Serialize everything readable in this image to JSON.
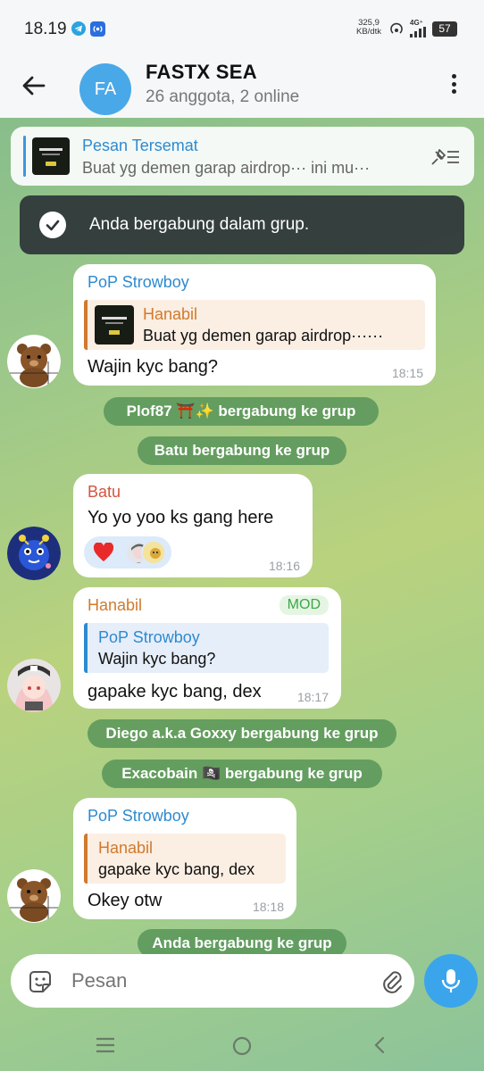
{
  "status_bar": {
    "time": "18.19",
    "net_speed_value": "325,9",
    "net_speed_unit": "KB/dtk",
    "network": "4G⁺",
    "battery": "57"
  },
  "header": {
    "avatar_initials": "FA",
    "title": "FASTX SEA",
    "subtitle": "26 anggota, 2 online"
  },
  "pinned": {
    "title": "Pesan Tersemat",
    "text": "Buat yg demen garap airdrop··· ini mu···"
  },
  "toast": {
    "text": "Anda bergabung dalam grup."
  },
  "messages": [
    {
      "sender": "PoP Strowboy",
      "sender_color": "#2e8ad0",
      "quote_name": "Hanabil",
      "quote_text": "Buat yg demen garap airdrop······",
      "text": "Wajin kyc bang?",
      "time": "18:15"
    },
    {
      "sender": "Batu",
      "sender_color": "#d2553f",
      "text": "Yo yo yoo ks gang here",
      "time": "18:16"
    },
    {
      "sender": "Hanabil",
      "sender_color": "#d07a2e",
      "badge": "MOD",
      "quote_name": "PoP Strowboy",
      "quote_text": "Wajin kyc bang?",
      "text": "gapake kyc bang, dex",
      "time": "18:17"
    },
    {
      "sender": "PoP Strowboy",
      "sender_color": "#2e8ad0",
      "quote_name": "Hanabil",
      "quote_text": "gapake kyc bang, dex",
      "text": "Okey otw",
      "time": "18:18"
    }
  ],
  "system_messages": {
    "plof": "Plof87 ⛩️✨ bergabung ke grup",
    "batu": "Batu bergabung ke grup",
    "diego": "Diego a.k.a Goxxy bergabung ke grup",
    "exacobain": "Exacobain 🏴‍☠️ bergabung ke grup",
    "anda": "Anda bergabung ke grup"
  },
  "reactions": [
    "heart"
  ],
  "input": {
    "placeholder": "Pesan"
  },
  "colors": {
    "accent": "#3ba5ec",
    "system_bg": "#5a965a"
  }
}
